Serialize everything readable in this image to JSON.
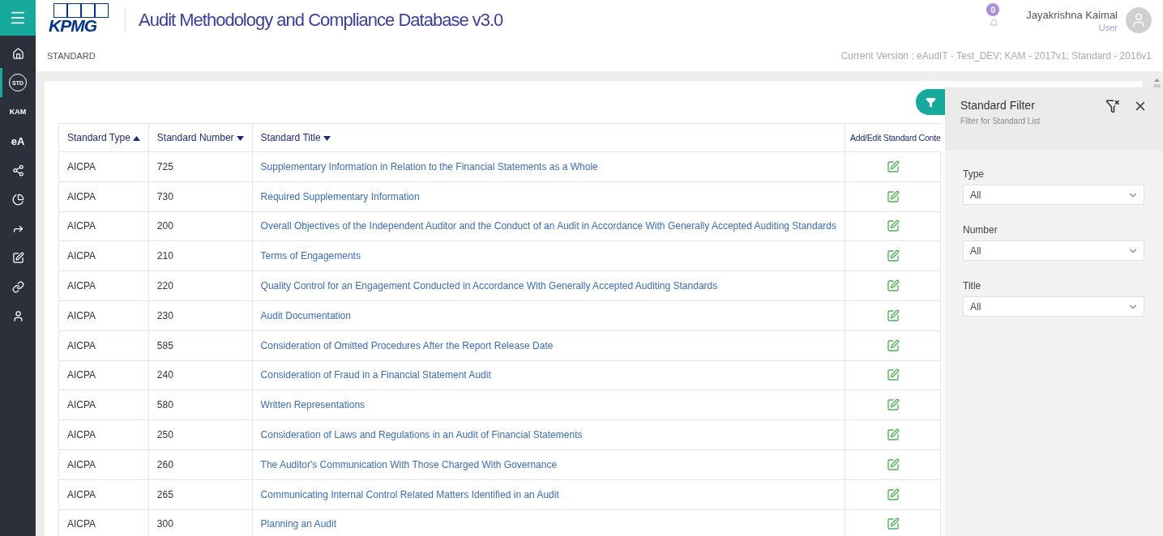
{
  "header": {
    "logo": "KPMG",
    "title": "Audit Methodology and Compliance Database v3.0",
    "notifications": "0",
    "user_name": "Jayakrishna Kaimal",
    "user_role": "User"
  },
  "sidebar": {
    "items": [
      {
        "kind": "home",
        "selected": false
      },
      {
        "kind": "circle",
        "label": "STD",
        "selected": true
      },
      {
        "kind": "text",
        "label": "KAM",
        "selected": false
      },
      {
        "kind": "text",
        "label": "eA",
        "selected": false
      },
      {
        "kind": "share",
        "selected": false
      },
      {
        "kind": "pie",
        "selected": false
      },
      {
        "kind": "forward",
        "selected": false
      },
      {
        "kind": "edit",
        "selected": false
      },
      {
        "kind": "link",
        "selected": false
      },
      {
        "kind": "user",
        "selected": false
      }
    ]
  },
  "breadcrumb": "STANDARD",
  "current_version": "Current Version : eAudIT - Test_DEV; KAM - 2017v1; Standard - 2016v1",
  "table": {
    "columns": [
      {
        "label": "Standard Type",
        "kind": "ascending"
      },
      {
        "label": "Standard Number",
        "kind": "descending"
      },
      {
        "label": "Standard Title",
        "kind": "descending"
      },
      {
        "label": "Add/Edit Standard Conte",
        "kind": "plain"
      }
    ],
    "rows": [
      {
        "type": "AICPA",
        "number": "725",
        "title": "Supplementary Information in Relation to the Financial Statements as a Whole"
      },
      {
        "type": "AICPA",
        "number": "730",
        "title": "Required Supplementary Information"
      },
      {
        "type": "AICPA",
        "number": "200",
        "title": "Overall Objectives of the Independent Auditor and the Conduct of an Audit in Accordance With Generally Accepted Auditing Standards"
      },
      {
        "type": "AICPA",
        "number": "210",
        "title": "Terms of Engagements"
      },
      {
        "type": "AICPA",
        "number": "220",
        "title": "Quality Control for an Engagement Conducted in Accordance With Generally Accepted Auditing Standards"
      },
      {
        "type": "AICPA",
        "number": "230",
        "title": "Audit Documentation"
      },
      {
        "type": "AICPA",
        "number": "585",
        "title": "Consideration of Omitted Procedures After the Report Release Date"
      },
      {
        "type": "AICPA",
        "number": "240",
        "title": "Consideration of Fraud in a Financial Statement Audit"
      },
      {
        "type": "AICPA",
        "number": "580",
        "title": "Written Representations"
      },
      {
        "type": "AICPA",
        "number": "250",
        "title": "Consideration of Laws and Regulations in an Audit of Financial Statements"
      },
      {
        "type": "AICPA",
        "number": "260",
        "title": "The Auditor's Communication With Those Charged With Governance"
      },
      {
        "type": "AICPA",
        "number": "265",
        "title": "Communicating Internal Control Related Matters Identified in an Audit"
      },
      {
        "type": "AICPA",
        "number": "300",
        "title": "Planning an Audit"
      }
    ]
  },
  "filter_panel": {
    "title": "Standard Filter",
    "subtitle": "Filter for Standard List",
    "fields": [
      {
        "label": "Type",
        "value": "All"
      },
      {
        "label": "Number",
        "value": "All"
      },
      {
        "label": "Title",
        "value": "All"
      }
    ]
  }
}
